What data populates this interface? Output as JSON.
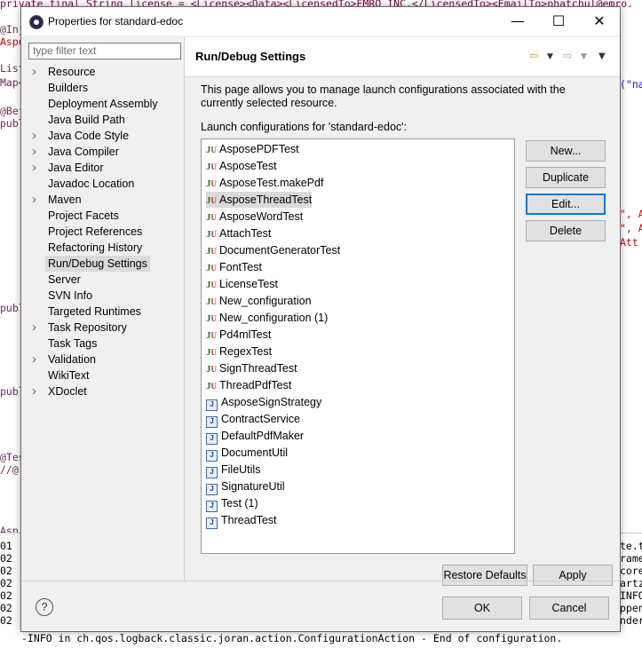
{
  "background": {
    "editor_lines": [
      "private final String license = <License><Data><LicensedTo>EMRO INC.</LicensedTo><EmailTo>phatchul@emro.",
      "@Inj",
      "Aspo",
      "List",
      "Map<",
      "@Bef",
      "publ",
      "publ",
      "publ",
      "@Tes",
      "//@",
      "Asp"
    ],
    "right_fragments": [
      "(\"na",
      "\", A",
      "\", A",
      "Att"
    ],
    "console_right": [
      "te.t",
      "rame",
      "core",
      "artz",
      "INFO",
      "ppen",
      "nder"
    ],
    "console_numbers": [
      "01",
      "02",
      "02",
      "02",
      "02",
      "02",
      "02"
    ],
    "console_last_line": "-INFO in ch.qos.logback.classic.joran.action.ConfigurationAction - End of configuration."
  },
  "dialog": {
    "title": "Properties for standard-edoc",
    "minimize_label": "—",
    "maximize_label": "☐",
    "close_label": "✕",
    "filter_placeholder": "type filter text",
    "tree": [
      {
        "label": "Resource",
        "expandable": true
      },
      {
        "label": "Builders",
        "expandable": false
      },
      {
        "label": "Deployment Assembly",
        "expandable": false
      },
      {
        "label": "Java Build Path",
        "expandable": false
      },
      {
        "label": "Java Code Style",
        "expandable": true
      },
      {
        "label": "Java Compiler",
        "expandable": true
      },
      {
        "label": "Java Editor",
        "expandable": true
      },
      {
        "label": "Javadoc Location",
        "expandable": false
      },
      {
        "label": "Maven",
        "expandable": true
      },
      {
        "label": "Project Facets",
        "expandable": false
      },
      {
        "label": "Project References",
        "expandable": false
      },
      {
        "label": "Refactoring History",
        "expandable": false
      },
      {
        "label": "Run/Debug Settings",
        "expandable": false,
        "selected": true
      },
      {
        "label": "Server",
        "expandable": false
      },
      {
        "label": "SVN Info",
        "expandable": false
      },
      {
        "label": "Targeted Runtimes",
        "expandable": false
      },
      {
        "label": "Task Repository",
        "expandable": true
      },
      {
        "label": "Task Tags",
        "expandable": false
      },
      {
        "label": "Validation",
        "expandable": true
      },
      {
        "label": "WikiText",
        "expandable": false
      },
      {
        "label": "XDoclet",
        "expandable": true
      }
    ],
    "page_title": "Run/Debug Settings",
    "description": "This page allows you to manage launch configurations associated with the currently selected resource.",
    "launch_label": "Launch configurations for 'standard-edoc':",
    "configurations": [
      {
        "label": "AsposePDFTest",
        "kind": "junit"
      },
      {
        "label": "AsposeTest",
        "kind": "junit"
      },
      {
        "label": "AsposeTest.makePdf",
        "kind": "junit"
      },
      {
        "label": "AsposeThreadTest",
        "kind": "junit",
        "selected": true
      },
      {
        "label": "AsposeWordTest",
        "kind": "junit"
      },
      {
        "label": "AttachTest",
        "kind": "junit"
      },
      {
        "label": "DocumentGeneratorTest",
        "kind": "junit"
      },
      {
        "label": "FontTest",
        "kind": "junit"
      },
      {
        "label": "LicenseTest",
        "kind": "junit"
      },
      {
        "label": "New_configuration",
        "kind": "junit"
      },
      {
        "label": "New_configuration (1)",
        "kind": "junit"
      },
      {
        "label": "Pd4mlTest",
        "kind": "junit"
      },
      {
        "label": "RegexTest",
        "kind": "junit"
      },
      {
        "label": "SignThreadTest",
        "kind": "junit"
      },
      {
        "label": "ThreadPdfTest",
        "kind": "junit"
      },
      {
        "label": "AsposeSignStrategy",
        "kind": "java"
      },
      {
        "label": "ContractService",
        "kind": "java"
      },
      {
        "label": "DefaultPdfMaker",
        "kind": "java"
      },
      {
        "label": "DocumentUtil",
        "kind": "java"
      },
      {
        "label": "FileUtils",
        "kind": "java"
      },
      {
        "label": "SignatureUtil",
        "kind": "java"
      },
      {
        "label": "Test (1)",
        "kind": "java"
      },
      {
        "label": "ThreadTest",
        "kind": "java"
      }
    ],
    "buttons": {
      "new": "New...",
      "duplicate": "Duplicate",
      "edit": "Edit...",
      "delete": "Delete",
      "restore_defaults": "Restore Defaults",
      "apply": "Apply",
      "ok": "OK",
      "cancel": "Cancel"
    },
    "help_glyph": "?",
    "colors": {
      "accent": "#0078d7",
      "selection": "#dadada"
    }
  }
}
